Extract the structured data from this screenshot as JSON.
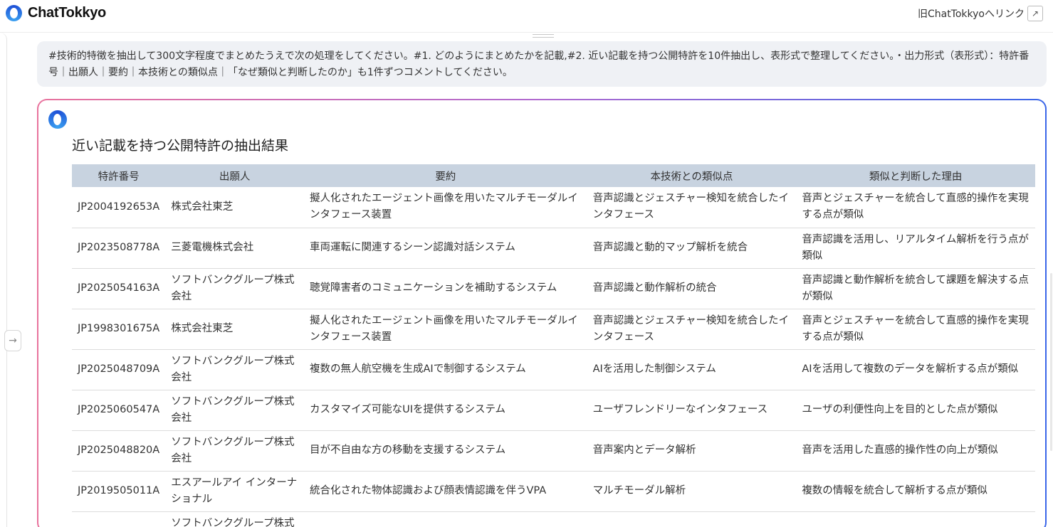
{
  "header": {
    "logo_text": "ChatTokkyo",
    "old_link": "旧ChatTokkyoへリンク"
  },
  "prompt": {
    "text": "#技術的特徴を抽出して300文字程度でまとめたうえで次の処理をしてください。#1. どのようにまとめたかを記載,#2. 近い記載を持つ公開特許を10件抽出し、表形式で整理してください。・出力形式（表形式）：特許番号｜出願人｜要約｜本技術との類似点｜「なぜ類似と判断したのか」も1件ずつコメントしてください。"
  },
  "answer": {
    "title": "近い記載を持つ公開特許の抽出結果",
    "table": {
      "headers": [
        "特許番号",
        "出願人",
        "要約",
        "本技術との類似点",
        "類似と判断した理由"
      ],
      "rows": [
        [
          "JP2004192653A",
          "株式会社東芝",
          "擬人化されたエージェント画像を用いたマルチモーダルインタフェース装置",
          "音声認識とジェスチャー検知を統合したインタフェース",
          "音声とジェスチャーを統合して直感的操作を実現する点が類似"
        ],
        [
          "JP2023508778A",
          "三菱電機株式会社",
          "車両運転に関連するシーン認識対話システム",
          "音声認識と動的マップ解析を統合",
          "音声認識を活用し、リアルタイム解析を行う点が類似"
        ],
        [
          "JP2025054163A",
          "ソフトバンクグループ株式会社",
          "聴覚障害者のコミュニケーションを補助するシステム",
          "音声認識と動作解析の統合",
          "音声認識と動作解析を統合して課題を解決する点が類似"
        ],
        [
          "JP1998301675A",
          "株式会社東芝",
          "擬人化されたエージェント画像を用いたマルチモーダルインタフェース装置",
          "音声認識とジェスチャー検知を統合したインタフェース",
          "音声とジェスチャーを統合して直感的操作を実現する点が類似"
        ],
        [
          "JP2025048709A",
          "ソフトバンクグループ株式会社",
          "複数の無人航空機を生成AIで制御するシステム",
          "AIを活用した制御システム",
          "AIを活用して複数のデータを解析する点が類似"
        ],
        [
          "JP2025060547A",
          "ソフトバンクグループ株式会社",
          "カスタマイズ可能なUIを提供するシステム",
          "ユーザフレンドリーなインタフェース",
          "ユーザの利便性向上を目的とした点が類似"
        ],
        [
          "JP2025048820A",
          "ソフトバンクグループ株式会社",
          "目が不自由な方の移動を支援するシステム",
          "音声案内とデータ解析",
          "音声を活用した直感的操作性の向上が類似"
        ],
        [
          "JP2019505011A",
          "エスアールアイ インターナショナル",
          "統合化された物体認識および顔表情認識を伴うVPA",
          "マルチモーダル解析",
          "複数の情報を統合して解析する点が類似"
        ],
        [
          "",
          "ソフトバンクグループ株式会社",
          "",
          "",
          ""
        ]
      ]
    }
  }
}
